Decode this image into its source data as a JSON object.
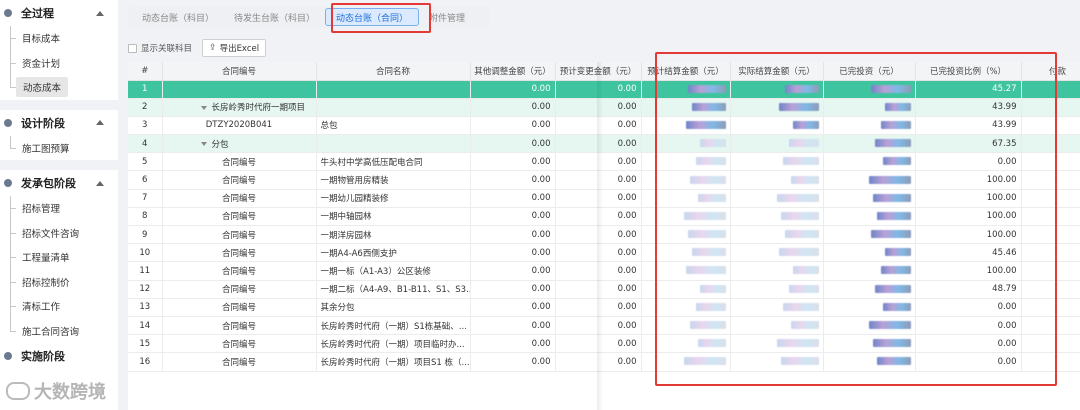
{
  "sidebar": {
    "sections": [
      {
        "title": "全过程",
        "items": [
          "目标成本",
          "资金计划",
          "动态成本"
        ],
        "active": 2
      },
      {
        "title": "设计阶段",
        "items": [
          "施工图预算"
        ]
      },
      {
        "title": "发承包阶段",
        "items": [
          "招标管理",
          "招标文件咨询",
          "工程量清单",
          "招标控制价",
          "清标工作",
          "施工合同咨询"
        ]
      },
      {
        "title": "实施阶段",
        "items": []
      }
    ]
  },
  "tabs": [
    {
      "label": "动态台账（科目）",
      "active": false
    },
    {
      "label": "待发生台账（科目）",
      "active": false
    },
    {
      "label": "动态台账（合同）",
      "active": true
    },
    {
      "label": "附件管理",
      "active": false
    }
  ],
  "toolbar": {
    "show_linked_label": "显示关联科目",
    "export_label": "导出Excel"
  },
  "table": {
    "columns": [
      "#",
      "合同编号",
      "合同名称",
      "其他调整金额（元）",
      "预计变更金额（元）",
      "预计结算金额（元）",
      "实际结算金额（元）",
      "已完投资（元）",
      "已完投资比例（%）",
      "付款"
    ],
    "rows": [
      {
        "idx": "1",
        "code": "",
        "name": "",
        "other": "0.00",
        "change": "0.00",
        "ratio": "45.27",
        "style": "sel",
        "level": 0
      },
      {
        "idx": "2",
        "code": "长房岭秀时代府一期项目",
        "name": "",
        "other": "0.00",
        "change": "0.00",
        "ratio": "43.99",
        "style": "tint",
        "level": 1,
        "expand": true
      },
      {
        "idx": "3",
        "code": "DTZY2020B041",
        "name": "总包",
        "other": "0.00",
        "change": "0.00",
        "ratio": "43.99",
        "style": "",
        "level": 2
      },
      {
        "idx": "4",
        "code": "分包",
        "name": "",
        "other": "0.00",
        "change": "0.00",
        "ratio": "67.35",
        "style": "tint",
        "level": 1,
        "expand": true
      },
      {
        "idx": "5",
        "code": "合同编号",
        "name": "牛头村中学高低压配电合同",
        "other": "0.00",
        "change": "0.00",
        "ratio": "0.00",
        "style": "",
        "level": 2
      },
      {
        "idx": "6",
        "code": "合同编号",
        "name": "一期物管用房精装",
        "other": "0.00",
        "change": "0.00",
        "ratio": "100.00",
        "style": "",
        "level": 2
      },
      {
        "idx": "7",
        "code": "合同编号",
        "name": "一期幼儿园精装修",
        "other": "0.00",
        "change": "0.00",
        "ratio": "100.00",
        "style": "",
        "level": 2
      },
      {
        "idx": "8",
        "code": "合同编号",
        "name": "一期中轴园林",
        "other": "0.00",
        "change": "0.00",
        "ratio": "100.00",
        "style": "",
        "level": 2
      },
      {
        "idx": "9",
        "code": "合同编号",
        "name": "一期洋房园林",
        "other": "0.00",
        "change": "0.00",
        "ratio": "100.00",
        "style": "",
        "level": 2
      },
      {
        "idx": "10",
        "code": "合同编号",
        "name": "一期A4-A6西侧支护",
        "other": "0.00",
        "change": "0.00",
        "ratio": "45.46",
        "style": "",
        "level": 2
      },
      {
        "idx": "11",
        "code": "合同编号",
        "name": "一期一标（A1-A3）公区装修",
        "other": "0.00",
        "change": "0.00",
        "ratio": "100.00",
        "style": "",
        "level": 2
      },
      {
        "idx": "12",
        "code": "合同编号",
        "name": "一期二标（A4-A9、B1-B11、S1、S3...",
        "other": "0.00",
        "change": "0.00",
        "ratio": "48.79",
        "style": "",
        "level": 2
      },
      {
        "idx": "13",
        "code": "合同编号",
        "name": "其余分包",
        "other": "0.00",
        "change": "0.00",
        "ratio": "0.00",
        "style": "",
        "level": 2
      },
      {
        "idx": "14",
        "code": "合同编号",
        "name": "长房岭秀时代府（一期）S1栋基础、...",
        "other": "0.00",
        "change": "0.00",
        "ratio": "0.00",
        "style": "",
        "level": 2
      },
      {
        "idx": "15",
        "code": "合同编号",
        "name": "长房岭秀时代府（一期）项目临时办...",
        "other": "0.00",
        "change": "0.00",
        "ratio": "0.00",
        "style": "",
        "level": 2
      },
      {
        "idx": "16",
        "code": "合同编号",
        "name": "长房岭秀时代府（一期）项目S1 栋（...",
        "other": "0.00",
        "change": "0.00",
        "ratio": "0.00",
        "style": "",
        "level": 2
      }
    ]
  },
  "watermark": "大数跨境",
  "colors": {
    "accent": "#3ec5a0",
    "highlight": "#e53935",
    "tab_active": "#1e6fd9"
  }
}
